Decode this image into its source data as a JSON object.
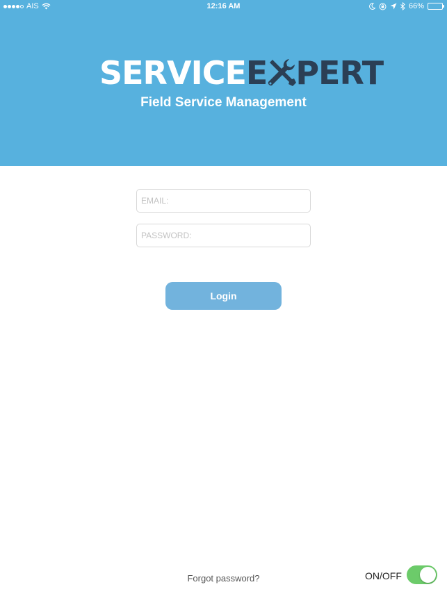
{
  "status_bar": {
    "carrier": "AIS",
    "time": "12:16 AM",
    "battery": "66%",
    "battery_level": 0.66
  },
  "logo": {
    "part1": "SERVICE",
    "part2_start": "E",
    "part2_end": "PERT",
    "subtitle": "Field Service Management"
  },
  "form": {
    "email_placeholder": "EMAIL:",
    "password_placeholder": "PASSWORD:",
    "login_label": "Login"
  },
  "footer": {
    "forgot_label": "Forgot password?",
    "toggle_label": "ON/OFF",
    "toggle_on": true
  },
  "colors": {
    "header": "#57b1de",
    "logo_dark": "#2b3f55",
    "button": "#72b3dd",
    "toggle": "#6ccb6a"
  }
}
